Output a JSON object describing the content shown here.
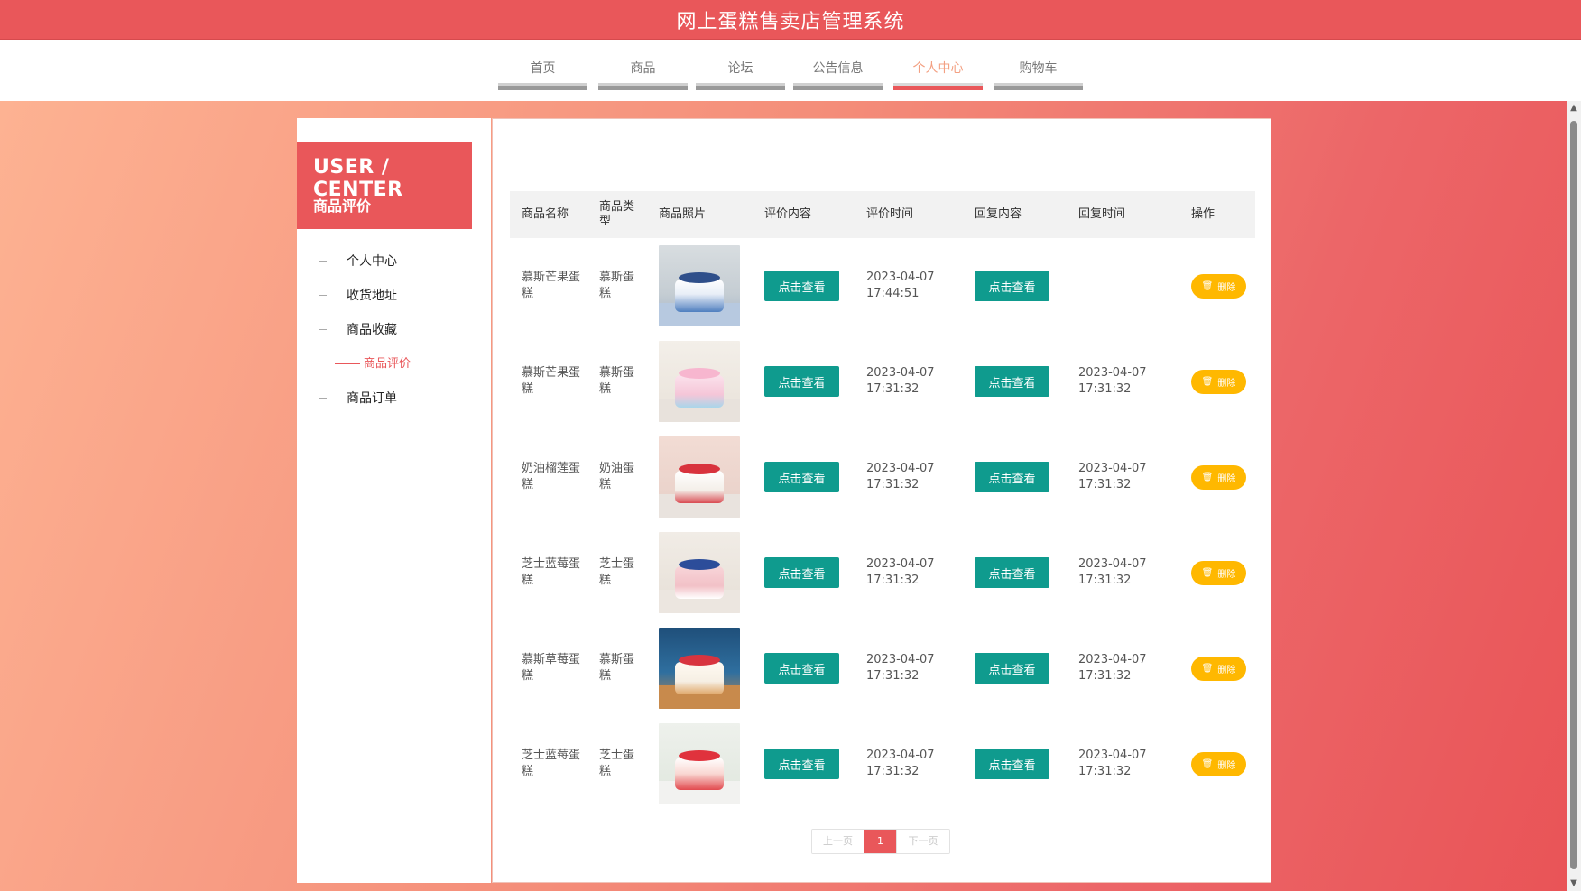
{
  "header": {
    "title": "网上蛋糕售卖店管理系统"
  },
  "nav": {
    "items": [
      {
        "label": "首页",
        "active": false
      },
      {
        "label": "商品",
        "active": false
      },
      {
        "label": "论坛",
        "active": false
      },
      {
        "label": "公告信息",
        "active": false
      },
      {
        "label": "个人中心",
        "active": true
      },
      {
        "label": "购物车",
        "active": false
      }
    ]
  },
  "sidebar": {
    "heading": "USER / CENTER",
    "subheading": "商品评价",
    "items": [
      {
        "label": "个人中心",
        "active": false
      },
      {
        "label": "收货地址",
        "active": false
      },
      {
        "label": "商品收藏",
        "active": false
      },
      {
        "label": "商品评价",
        "active": true
      },
      {
        "label": "商品订单",
        "active": false
      }
    ]
  },
  "table": {
    "headers": [
      "商品名称",
      "商品类型",
      "商品照片",
      "评价内容",
      "评价时间",
      "回复内容",
      "回复时间",
      "操作"
    ],
    "view_label": "点击查看",
    "delete_label": "删除",
    "rows": [
      {
        "name": "慕斯芒果蛋糕",
        "type": "慕斯蛋糕",
        "photo": "blue-birthday-cake-photo",
        "date": "2023-04-07",
        "time": "17:44:51",
        "reply_date": "",
        "reply_time": ""
      },
      {
        "name": "慕斯芒果蛋糕",
        "type": "慕斯蛋糕",
        "photo": "heart-pink-cake-photo",
        "date": "2023-04-07",
        "time": "17:31:32",
        "reply_date": "2023-04-07",
        "reply_time": "17:31:32"
      },
      {
        "name": "奶油榴莲蛋糕",
        "type": "奶油蛋糕",
        "photo": "strawberry-cream-cakes-photo",
        "date": "2023-04-07",
        "time": "17:31:32",
        "reply_date": "2023-04-07",
        "reply_time": "17:31:32"
      },
      {
        "name": "芝士蓝莓蛋糕",
        "type": "芝士蛋糕",
        "photo": "blue-heart-cake-photo",
        "date": "2023-04-07",
        "time": "17:31:32",
        "reply_date": "2023-04-07",
        "reply_time": "17:31:32"
      },
      {
        "name": "慕斯草莓蛋糕",
        "type": "慕斯蛋糕",
        "photo": "red-heart-cake-photo",
        "date": "2023-04-07",
        "time": "17:31:32",
        "reply_date": "2023-04-07",
        "reply_time": "17:31:32"
      },
      {
        "name": "芝士蓝莓蛋糕",
        "type": "芝士蛋糕",
        "photo": "strawberry-slice-cake-photo",
        "date": "2023-04-07",
        "time": "17:31:32",
        "reply_date": "2023-04-07",
        "reply_time": "17:31:32"
      }
    ]
  },
  "pager": {
    "prev": "上一页",
    "current": "1",
    "next": "下一页"
  },
  "colors": {
    "brand": "#e9575a",
    "teal": "#0f9b8e",
    "amber": "#ffb800",
    "nav_active": "#f3a082"
  },
  "icons": {
    "scroll_up": "scroll-up-arrow-icon",
    "scroll_down": "scroll-down-arrow-icon",
    "delete": "trash-icon"
  }
}
